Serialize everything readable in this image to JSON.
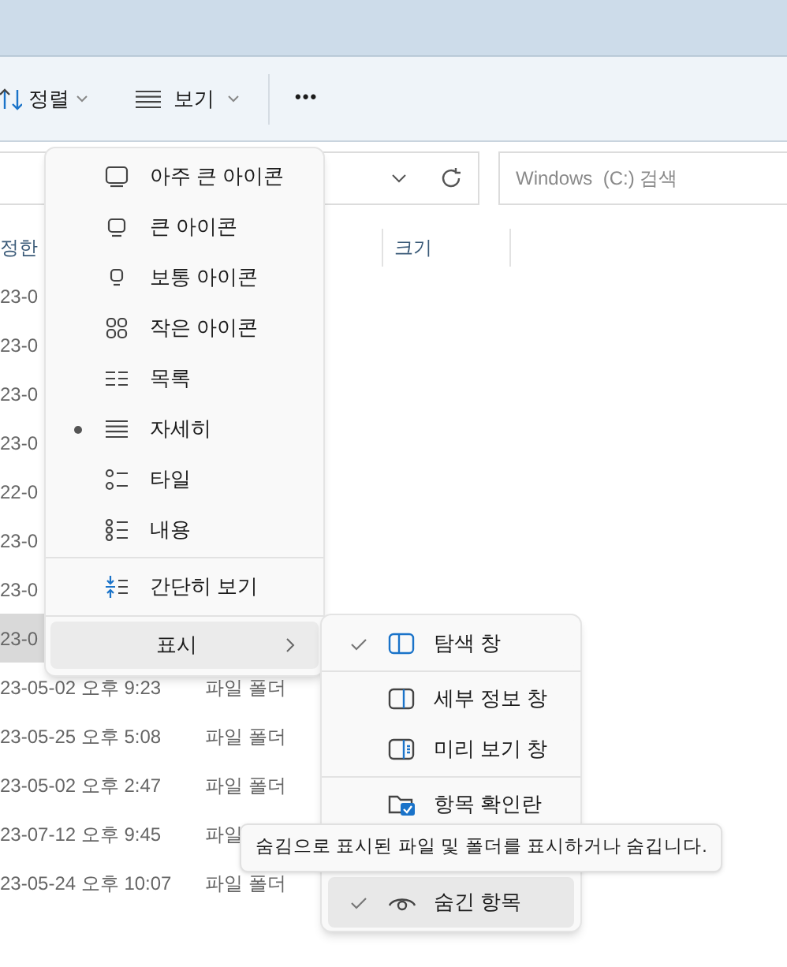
{
  "toolbar": {
    "sort_label": "정렬",
    "view_label": "보기",
    "more_label": "•••"
  },
  "search": {
    "placeholder": "Windows  (C:) 검색"
  },
  "columns": [
    "정한",
    "크기"
  ],
  "rows": [
    {
      "date": "23-0",
      "type": "",
      "selected": false
    },
    {
      "date": "23-0",
      "type": "",
      "selected": false
    },
    {
      "date": "23-0",
      "type": "",
      "selected": false
    },
    {
      "date": "23-0",
      "type": "",
      "selected": false
    },
    {
      "date": "22-0",
      "type": "",
      "selected": false
    },
    {
      "date": "23-0",
      "type": "",
      "selected": false
    },
    {
      "date": "23-0",
      "type": "",
      "selected": false
    },
    {
      "date": "23-0",
      "type": "",
      "selected": true
    },
    {
      "date": "23-05-02 오후 9:23",
      "type": "파일 폴더",
      "selected": false
    },
    {
      "date": "23-05-25 오후 5:08",
      "type": "파일 폴더",
      "selected": false
    },
    {
      "date": "23-05-02 오후 2:47",
      "type": "파일 폴더",
      "selected": false
    },
    {
      "date": "23-07-12 오후 9:45",
      "type": "파일",
      "selected": false
    },
    {
      "date": "23-05-24 오후 10:07",
      "type": "파일 폴더",
      "selected": false
    }
  ],
  "view_menu": {
    "items": [
      {
        "kind": "extra-large",
        "label": "아주 큰 아이콘",
        "selected": false
      },
      {
        "kind": "large",
        "label": "큰 아이콘",
        "selected": false
      },
      {
        "kind": "medium",
        "label": "보통 아이콘",
        "selected": false
      },
      {
        "kind": "small",
        "label": "작은 아이콘",
        "selected": false
      },
      {
        "kind": "list",
        "label": "목록",
        "selected": false
      },
      {
        "kind": "details",
        "label": "자세히",
        "selected": true
      },
      {
        "kind": "tiles",
        "label": "타일",
        "selected": false
      },
      {
        "kind": "content",
        "label": "내용",
        "selected": false
      },
      {
        "kind": "compact",
        "label": "간단히 보기",
        "selected": false
      },
      {
        "kind": "show",
        "label": "표시",
        "expanded": true
      }
    ]
  },
  "show_menu": {
    "items": [
      {
        "kind": "nav-pane",
        "label": "탐색 창",
        "checked": true,
        "highlighted": false
      },
      {
        "kind": "details-pane",
        "label": "세부 정보 창",
        "checked": false,
        "highlighted": false
      },
      {
        "kind": "preview-pane",
        "label": "미리 보기 창",
        "checked": false,
        "highlighted": false
      },
      {
        "kind": "checkboxes",
        "label": "항목 확인란",
        "checked": false,
        "highlighted": false
      },
      {
        "kind": "hidden",
        "label": "숨긴 항목",
        "checked": true,
        "highlighted": true
      }
    ]
  },
  "tooltip": "숨김으로 표시된 파일 및 폴더를 표시하거나 숨깁니다."
}
